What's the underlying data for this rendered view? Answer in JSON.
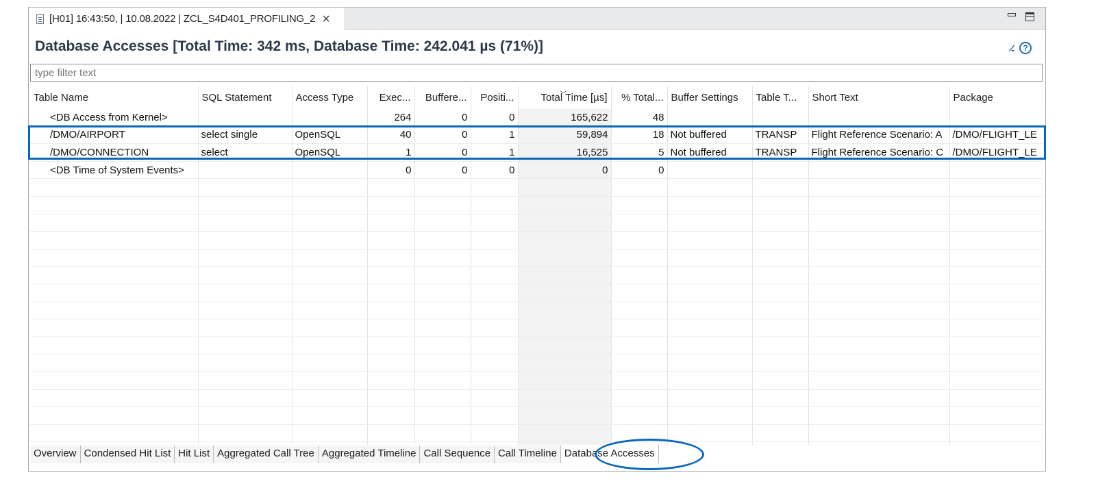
{
  "editor_tab": {
    "title": "[H01] 16:43:50, | 10.08.2022 | ZCL_S4D401_PROFILING_2",
    "close": "×"
  },
  "heading": "Database Accesses [Total Time: 342 ms, Database Time: 242.041 µs (71%)]",
  "header_icons": {
    "columns_glyph": "⁄⁄..",
    "help_glyph": "?"
  },
  "filter": {
    "placeholder": "type filter text"
  },
  "table": {
    "columns": [
      "Table Name",
      "SQL Statement",
      "Access Type",
      "Exec...",
      "Buffere...",
      "Positi...",
      "Total Time [µs]",
      "% Total...",
      "Buffer Settings",
      "Table T...",
      "Short Text",
      "Package"
    ],
    "rows": [
      [
        "<DB Access from Kernel>",
        "",
        "",
        "264",
        "0",
        "0",
        "165,622",
        "48",
        "",
        "",
        "",
        ""
      ],
      [
        "/DMO/AIRPORT",
        "select single",
        "OpenSQL",
        "40",
        "0",
        "1",
        "59,894",
        "18",
        "Not buffered",
        "TRANSP",
        "Flight Reference Scenario: A",
        "/DMO/FLIGHT_LE"
      ],
      [
        "/DMO/CONNECTION",
        "select",
        "OpenSQL",
        "1",
        "0",
        "1",
        "16,525",
        "5",
        "Not buffered",
        "TRANSP",
        "Flight Reference Scenario: C",
        "/DMO/FLIGHT_LE"
      ],
      [
        "<DB Time of System Events>",
        "",
        "",
        "0",
        "0",
        "0",
        "0",
        "0",
        "",
        "",
        "",
        ""
      ]
    ],
    "empty_rows": 16
  },
  "bottom_tabs": [
    "Overview",
    "Condensed Hit List",
    "Hit List",
    "Aggregated Call Tree",
    "Aggregated Timeline",
    "Call Sequence",
    "Call Timeline",
    "Database Accesses"
  ],
  "active_bottom_tab": "Database Accesses",
  "colors": {
    "highlight": "#0a66b8",
    "heading": "#2b3a4a",
    "sorted_column_bg": "#f3f3f3"
  }
}
